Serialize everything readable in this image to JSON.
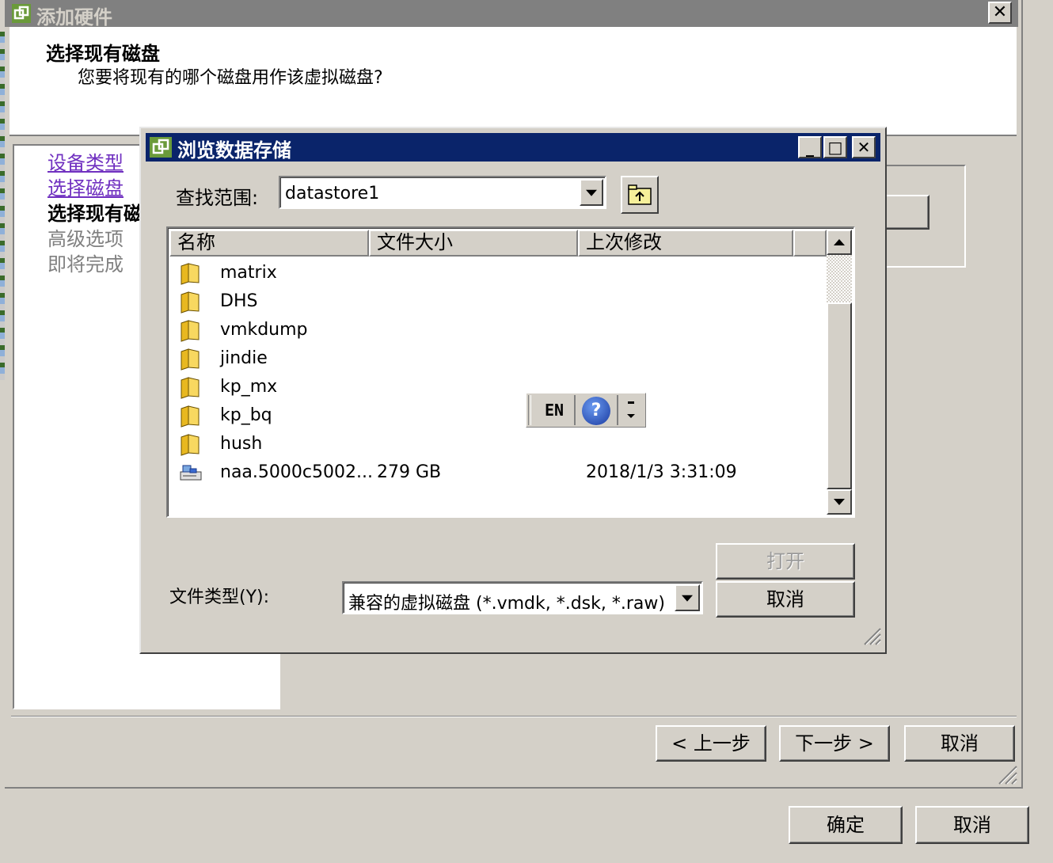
{
  "wizard": {
    "title": "添加硬件",
    "heading": "选择现有磁盘",
    "subheading": "您要将现有的哪个磁盘用作该虚拟磁盘?",
    "nav": [
      {
        "label": "设备类型",
        "state": "link"
      },
      {
        "label": "选择磁盘",
        "state": "link"
      },
      {
        "label": "选择现有磁",
        "state": "current"
      },
      {
        "label": "高级选项",
        "state": "disabled"
      },
      {
        "label": "即将完成",
        "state": "disabled"
      }
    ],
    "back_label": "< 上一步",
    "next_label": "下一步 >",
    "cancel_label": "取消",
    "close_glyph": "✕"
  },
  "dialog": {
    "title": "浏览数据存储",
    "look_in_label": "查找范围:",
    "look_in_value": "datastore1",
    "columns": [
      "名称",
      "文件大小",
      "上次修改"
    ],
    "rows": [
      {
        "name": "matrix",
        "size": "",
        "modified": "",
        "icon": "folder-icon"
      },
      {
        "name": "DHS",
        "size": "",
        "modified": "",
        "icon": "folder-icon"
      },
      {
        "name": "vmkdump",
        "size": "",
        "modified": "",
        "icon": "folder-icon"
      },
      {
        "name": "jindie",
        "size": "",
        "modified": "",
        "icon": "folder-icon"
      },
      {
        "name": "kp_mx",
        "size": "",
        "modified": "",
        "icon": "folder-icon"
      },
      {
        "name": "kp_bq",
        "size": "",
        "modified": "",
        "icon": "folder-icon"
      },
      {
        "name": "hush",
        "size": "",
        "modified": "",
        "icon": "folder-icon"
      },
      {
        "name": "naa.5000c5002...",
        "size": "279 GB",
        "modified": "2018/1/3 3:31:09",
        "icon": "disk-icon"
      }
    ],
    "file_type_label": "文件类型(Y):",
    "file_type_value": "兼容的虚拟磁盘 (*.vmdk, *.dsk, *.raw)",
    "open_label": "打开",
    "cancel_label": "取消",
    "minimize_glyph": "_",
    "maximize_glyph": "□",
    "close_glyph": "✕"
  },
  "language_bar": {
    "lang": "EN",
    "help_glyph": "?"
  },
  "host": {
    "ok_label": "确定",
    "cancel_label": "取消"
  },
  "colors": {
    "dialog_title_bg": "#0a246a",
    "window_bg": "#d4d0c8",
    "link": "#7030c0",
    "inactive_title": "#808080"
  }
}
